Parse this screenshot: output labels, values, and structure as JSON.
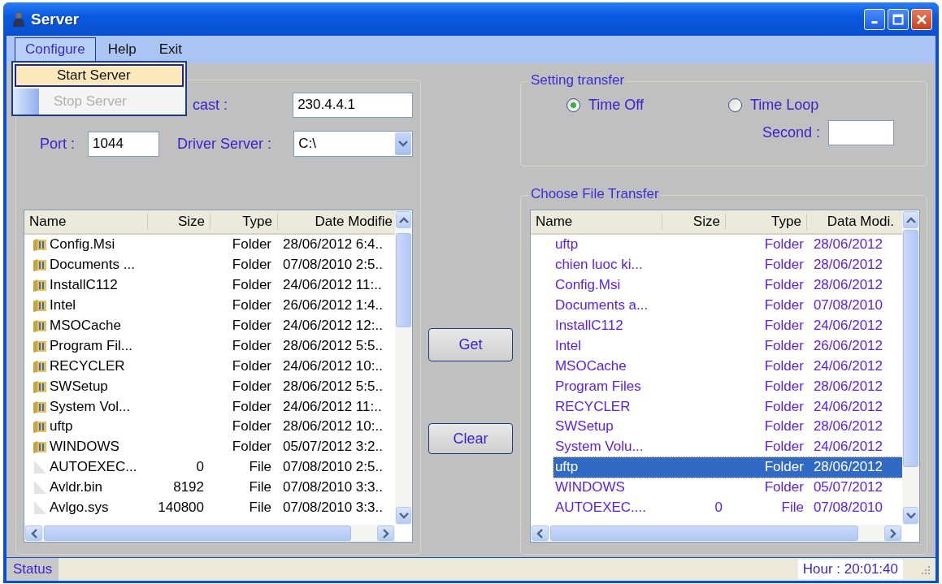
{
  "window": {
    "title": "Server"
  },
  "menu": [
    {
      "label": "Configure",
      "selected": true
    },
    {
      "label": "Help",
      "selected": false
    },
    {
      "label": "Exit",
      "selected": false
    }
  ],
  "dropdown": [
    {
      "label": "Start Server",
      "selected": true,
      "disabled": false
    },
    {
      "label": "Stop Server",
      "selected": false,
      "disabled": true
    }
  ],
  "connection": {
    "multicast_label": "cast :",
    "multicast": "230.4.4.1",
    "port_label": "Port :",
    "port": "1044",
    "driver_label": "Driver Server :",
    "driver": "C:\\"
  },
  "server_files": {
    "columns": [
      "Name",
      "Size",
      "Type",
      "Date Modifie"
    ],
    "rows": [
      {
        "kind": "folder",
        "name": "Config.Msi",
        "type": "Folder",
        "date": "28/06/2012 6:4.."
      },
      {
        "kind": "folder",
        "name": "Documents ...",
        "type": "Folder",
        "date": "07/08/2010 2:5.."
      },
      {
        "kind": "folder",
        "name": "InstallC112",
        "type": "Folder",
        "date": "24/06/2012 11:.."
      },
      {
        "kind": "folder",
        "name": "Intel",
        "type": "Folder",
        "date": "26/06/2012 1:4.."
      },
      {
        "kind": "folder",
        "name": "MSOCache",
        "type": "Folder",
        "date": "24/06/2012 12:.."
      },
      {
        "kind": "folder",
        "name": "Program Fil...",
        "type": "Folder",
        "date": "28/06/2012 5:5.."
      },
      {
        "kind": "folder",
        "name": "RECYCLER",
        "type": "Folder",
        "date": "24/06/2012 10:.."
      },
      {
        "kind": "folder",
        "name": "SWSetup",
        "type": "Folder",
        "date": "28/06/2012 5:5.."
      },
      {
        "kind": "folder",
        "name": "System Vol...",
        "type": "Folder",
        "date": "24/06/2012 11:.."
      },
      {
        "kind": "folder",
        "name": "uftp",
        "type": "Folder",
        "date": "28/06/2012 10:.."
      },
      {
        "kind": "folder",
        "name": "WINDOWS",
        "type": "Folder",
        "date": "05/07/2012 3:2.."
      },
      {
        "kind": "file",
        "name": "AUTOEXEC...",
        "size": "0",
        "type": "File",
        "date": "07/08/2010 2:5.."
      },
      {
        "kind": "file",
        "name": "Avldr.bin",
        "size": "8192",
        "type": "File",
        "date": "07/08/2010 3:3.."
      },
      {
        "kind": "file",
        "name": "Avlgo.sys",
        "size": "140800",
        "type": "File",
        "date": "07/08/2010 3:3.."
      }
    ]
  },
  "buttons": [
    "Get",
    "Clear"
  ],
  "setting_transfer": {
    "title": "Setting transfer",
    "options": [
      {
        "label": "Time Off",
        "selected": true
      },
      {
        "label": "Time Loop",
        "selected": false
      }
    ],
    "second_label": "Second :"
  },
  "file_transfer": {
    "title": "Choose File Transfer",
    "columns": [
      "Name",
      "Size",
      "Type",
      "Data Modi."
    ],
    "rows": [
      {
        "name": "uftp",
        "type": "Folder",
        "date": "28/06/2012",
        "selected": false
      },
      {
        "name": "chien luoc ki...",
        "type": "Folder",
        "date": "28/06/2012",
        "selected": false
      },
      {
        "name": "Config.Msi",
        "type": "Folder",
        "date": "28/06/2012",
        "selected": false
      },
      {
        "name": "Documents a...",
        "type": "Folder",
        "date": "07/08/2010",
        "selected": false
      },
      {
        "name": "InstallC112",
        "type": "Folder",
        "date": "24/06/2012",
        "selected": false
      },
      {
        "name": "Intel",
        "type": "Folder",
        "date": "26/06/2012",
        "selected": false
      },
      {
        "name": "MSOCache",
        "type": "Folder",
        "date": "24/06/2012",
        "selected": false
      },
      {
        "name": "Program Files",
        "type": "Folder",
        "date": "28/06/2012",
        "selected": false
      },
      {
        "name": "RECYCLER",
        "type": "Folder",
        "date": "24/06/2012",
        "selected": false
      },
      {
        "name": "SWSetup",
        "type": "Folder",
        "date": "28/06/2012",
        "selected": false
      },
      {
        "name": "System Volu...",
        "type": "Folder",
        "date": "24/06/2012",
        "selected": false
      },
      {
        "name": "uftp",
        "type": "Folder",
        "date": "28/06/2012",
        "selected": true
      },
      {
        "name": "WINDOWS",
        "type": "Folder",
        "date": "05/07/2012",
        "selected": false
      },
      {
        "name": "AUTOEXEC....",
        "size": "0",
        "type": "File",
        "date": "07/08/2010",
        "selected": false
      }
    ]
  },
  "status_bar": {
    "status": "Status",
    "hour": "Hour : 20:01:40"
  }
}
